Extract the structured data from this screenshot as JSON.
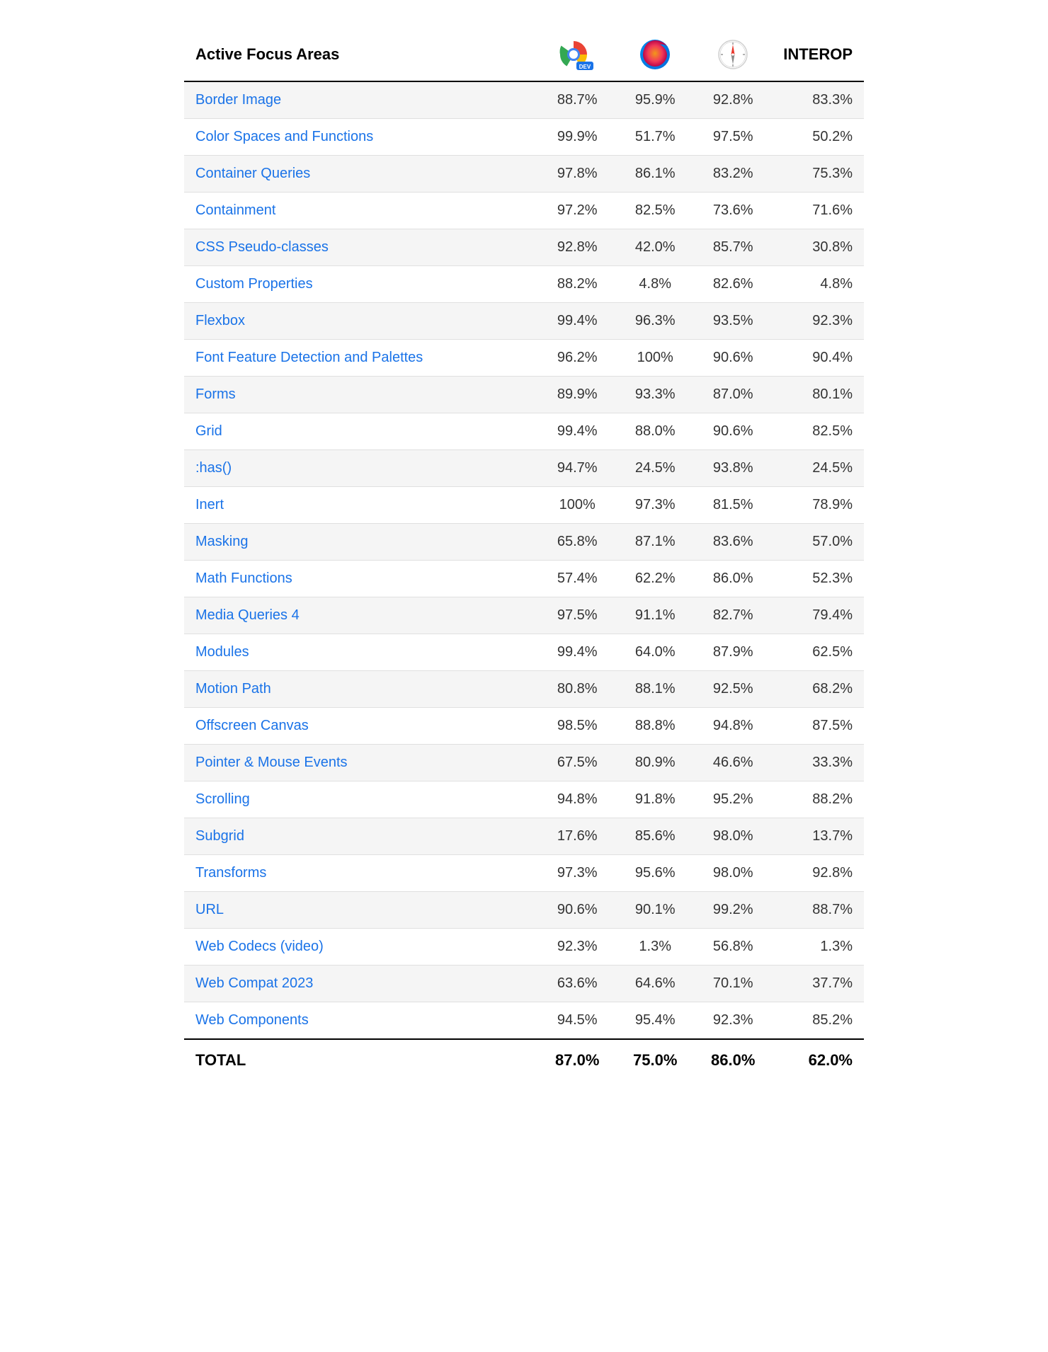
{
  "header": {
    "title": "Active Focus Areas",
    "interop_label": "INTEROP"
  },
  "columns": {
    "chrome_dev_label": "Chrome Dev",
    "firefox_label": "Firefox",
    "safari_label": "Safari"
  },
  "rows": [
    {
      "name": "Border Image",
      "chrome": "88.7%",
      "firefox": "95.9%",
      "safari": "92.8%",
      "interop": "83.3%"
    },
    {
      "name": "Color Spaces and Functions",
      "chrome": "99.9%",
      "firefox": "51.7%",
      "safari": "97.5%",
      "interop": "50.2%"
    },
    {
      "name": "Container Queries",
      "chrome": "97.8%",
      "firefox": "86.1%",
      "safari": "83.2%",
      "interop": "75.3%"
    },
    {
      "name": "Containment",
      "chrome": "97.2%",
      "firefox": "82.5%",
      "safari": "73.6%",
      "interop": "71.6%"
    },
    {
      "name": "CSS Pseudo-classes",
      "chrome": "92.8%",
      "firefox": "42.0%",
      "safari": "85.7%",
      "interop": "30.8%"
    },
    {
      "name": "Custom Properties",
      "chrome": "88.2%",
      "firefox": "4.8%",
      "safari": "82.6%",
      "interop": "4.8%"
    },
    {
      "name": "Flexbox",
      "chrome": "99.4%",
      "firefox": "96.3%",
      "safari": "93.5%",
      "interop": "92.3%"
    },
    {
      "name": "Font Feature Detection and Palettes",
      "chrome": "96.2%",
      "firefox": "100%",
      "safari": "90.6%",
      "interop": "90.4%"
    },
    {
      "name": "Forms",
      "chrome": "89.9%",
      "firefox": "93.3%",
      "safari": "87.0%",
      "interop": "80.1%"
    },
    {
      "name": "Grid",
      "chrome": "99.4%",
      "firefox": "88.0%",
      "safari": "90.6%",
      "interop": "82.5%"
    },
    {
      "name": ":has()",
      "chrome": "94.7%",
      "firefox": "24.5%",
      "safari": "93.8%",
      "interop": "24.5%"
    },
    {
      "name": "Inert",
      "chrome": "100%",
      "firefox": "97.3%",
      "safari": "81.5%",
      "interop": "78.9%"
    },
    {
      "name": "Masking",
      "chrome": "65.8%",
      "firefox": "87.1%",
      "safari": "83.6%",
      "interop": "57.0%"
    },
    {
      "name": "Math Functions",
      "chrome": "57.4%",
      "firefox": "62.2%",
      "safari": "86.0%",
      "interop": "52.3%"
    },
    {
      "name": "Media Queries 4",
      "chrome": "97.5%",
      "firefox": "91.1%",
      "safari": "82.7%",
      "interop": "79.4%"
    },
    {
      "name": "Modules",
      "chrome": "99.4%",
      "firefox": "64.0%",
      "safari": "87.9%",
      "interop": "62.5%"
    },
    {
      "name": "Motion Path",
      "chrome": "80.8%",
      "firefox": "88.1%",
      "safari": "92.5%",
      "interop": "68.2%"
    },
    {
      "name": "Offscreen Canvas",
      "chrome": "98.5%",
      "firefox": "88.8%",
      "safari": "94.8%",
      "interop": "87.5%"
    },
    {
      "name": "Pointer & Mouse Events",
      "chrome": "67.5%",
      "firefox": "80.9%",
      "safari": "46.6%",
      "interop": "33.3%"
    },
    {
      "name": "Scrolling",
      "chrome": "94.8%",
      "firefox": "91.8%",
      "safari": "95.2%",
      "interop": "88.2%"
    },
    {
      "name": "Subgrid",
      "chrome": "17.6%",
      "firefox": "85.6%",
      "safari": "98.0%",
      "interop": "13.7%"
    },
    {
      "name": "Transforms",
      "chrome": "97.3%",
      "firefox": "95.6%",
      "safari": "98.0%",
      "interop": "92.8%"
    },
    {
      "name": "URL",
      "chrome": "90.6%",
      "firefox": "90.1%",
      "safari": "99.2%",
      "interop": "88.7%"
    },
    {
      "name": "Web Codecs (video)",
      "chrome": "92.3%",
      "firefox": "1.3%",
      "safari": "56.8%",
      "interop": "1.3%"
    },
    {
      "name": "Web Compat 2023",
      "chrome": "63.6%",
      "firefox": "64.6%",
      "safari": "70.1%",
      "interop": "37.7%"
    },
    {
      "name": "Web Components",
      "chrome": "94.5%",
      "firefox": "95.4%",
      "safari": "92.3%",
      "interop": "85.2%"
    }
  ],
  "footer": {
    "label": "TOTAL",
    "chrome": "87.0%",
    "firefox": "75.0%",
    "safari": "86.0%",
    "interop": "62.0%"
  }
}
